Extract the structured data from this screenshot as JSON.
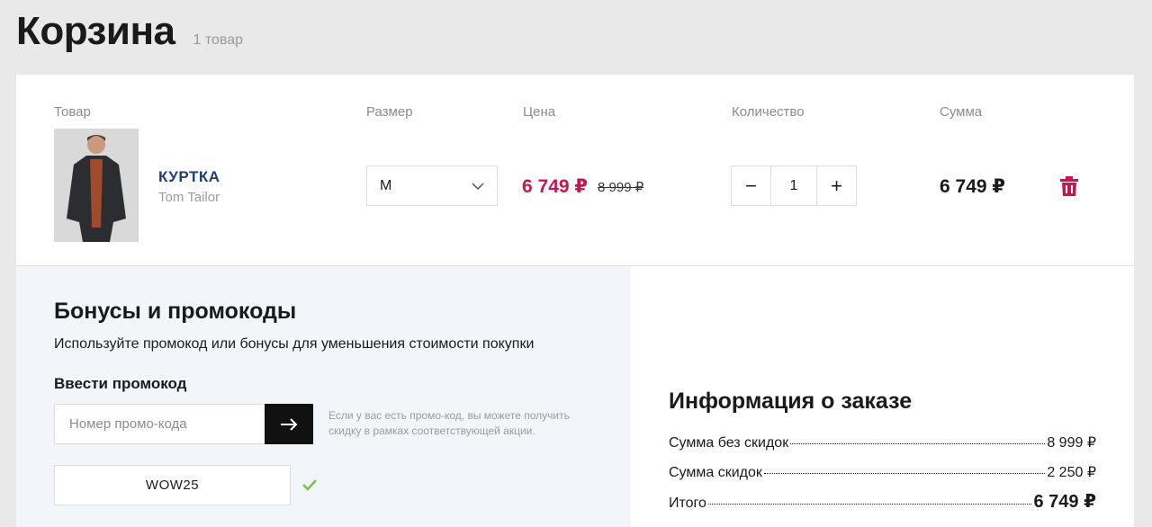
{
  "header": {
    "title": "Корзина",
    "count": "1 товар"
  },
  "columns": {
    "product": "Товар",
    "size": "Размер",
    "price": "Цена",
    "quantity": "Количество",
    "sum": "Сумма"
  },
  "item": {
    "name": "КУРТКА",
    "brand": "Tom Tailor",
    "size": "M",
    "price": "6 749 ₽",
    "old_price": "8 999 ₽",
    "quantity": "1",
    "minus": "−",
    "plus": "+",
    "sum": "6 749 ₽"
  },
  "promo": {
    "title": "Бонусы и промокоды",
    "description": "Используйте промокод или бонусы для уменьшения стоимости покупки",
    "enter_label": "Ввести промокод",
    "placeholder": "Номер промо-кода",
    "hint": "Если у вас есть промо-код, вы можете получить скидку в рамках соответствующей акции.",
    "applied_code": "WOW25"
  },
  "summary": {
    "title": "Информация о заказе",
    "rows": [
      {
        "label": "Сумма без скидок",
        "value": "8 999 ₽"
      },
      {
        "label": "Сумма скидок",
        "value": "2 250 ₽"
      }
    ],
    "total": {
      "label": "Итого",
      "value": "6 749 ₽"
    }
  },
  "colors": {
    "accent": "#c8174f",
    "link": "#1e3f78",
    "check": "#7cc242"
  },
  "icons": [
    "chevron-down-icon",
    "arrow-right-icon",
    "trash-icon",
    "check-icon"
  ]
}
